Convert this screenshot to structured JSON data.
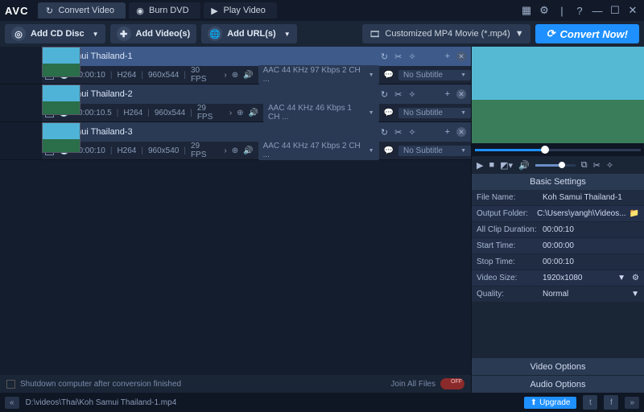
{
  "app": {
    "logo": "AVC"
  },
  "tabs": [
    {
      "label": "Convert Video",
      "active": true
    },
    {
      "label": "Burn DVD",
      "active": false
    },
    {
      "label": "Play Video",
      "active": false
    }
  ],
  "toolbar": {
    "addDisc": "Add CD Disc",
    "addVideos": "Add Video(s)",
    "addUrls": "Add URL(s)",
    "profile": "Customized MP4 Movie (*.mp4)",
    "convert": "Convert Now!"
  },
  "files": [
    {
      "name": "Koh Samui Thailand-1",
      "selected": true,
      "checked": true,
      "duration": "00:00:10",
      "codec": "H264",
      "res": "960x544",
      "fps": "30 FPS",
      "audio": "AAC 44 KHz 97 Kbps 2 CH ...",
      "subtitle": "No Subtitle"
    },
    {
      "name": "Koh Samui Thailand-2",
      "selected": false,
      "checked": true,
      "duration": "00:00:10.5",
      "codec": "H264",
      "res": "960x544",
      "fps": "29 FPS",
      "audio": "AAC 44 KHz 46 Kbps 1 CH ...",
      "subtitle": "No Subtitle"
    },
    {
      "name": "Koh Samui Thailand-3",
      "selected": false,
      "checked": true,
      "duration": "00:00:10",
      "codec": "H264",
      "res": "960x540",
      "fps": "29 FPS",
      "audio": "AAC 44 KHz 47 Kbps 2 CH ...",
      "subtitle": "No Subtitle"
    }
  ],
  "bottom": {
    "shutdown": "Shutdown computer after conversion finished",
    "joinAll": "Join All Files",
    "toggleLabel": "OFF"
  },
  "status": {
    "path": "D:\\videos\\Thai\\Koh Samui Thailand-1.mp4",
    "upgrade": "Upgrade"
  },
  "settings": {
    "title": "Basic Settings",
    "rows": [
      {
        "lbl": "File Name:",
        "val": "Koh Samui Thailand-1"
      },
      {
        "lbl": "Output Folder:",
        "val": "C:\\Users\\yangh\\Videos...",
        "folder": true
      },
      {
        "lbl": "All Clip Duration:",
        "val": "00:00:10"
      },
      {
        "lbl": "Start Time:",
        "val": "00:00:00"
      },
      {
        "lbl": "Stop Time:",
        "val": "00:00:10"
      },
      {
        "lbl": "Video Size:",
        "val": "1920x1080",
        "dd": true,
        "gear": true
      },
      {
        "lbl": "Quality:",
        "val": "Normal",
        "dd": true
      }
    ],
    "videoOpts": "Video Options",
    "audioOpts": "Audio Options"
  }
}
